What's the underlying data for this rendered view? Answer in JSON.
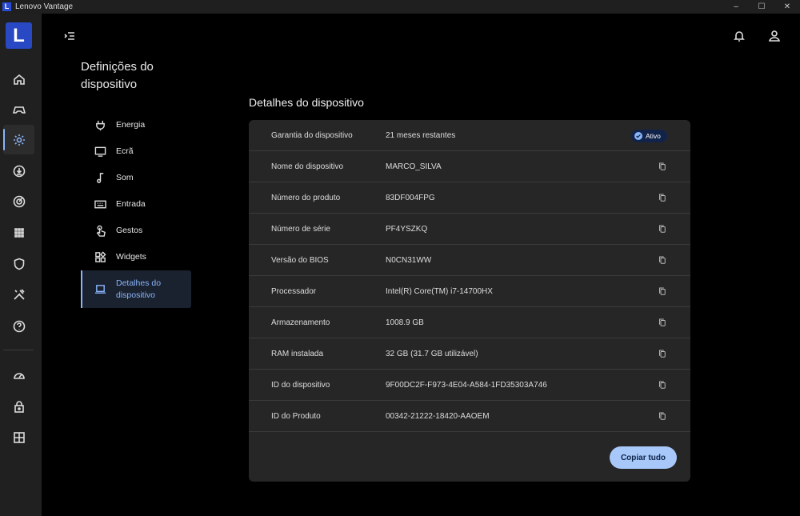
{
  "window": {
    "title": "Lenovo Vantage",
    "logo": "L",
    "minimize": "–",
    "maximize": "☐",
    "close": "✕"
  },
  "rail": {
    "brand": "L",
    "items": [
      "home-icon",
      "gamepad-icon",
      "gear-icon",
      "download-icon",
      "radar-icon",
      "apps-grid-icon",
      "shield-icon",
      "tools-icon",
      "help-icon",
      "speedometer-icon",
      "lock-icon",
      "dashboard-icon"
    ],
    "active": "gear-icon"
  },
  "section": {
    "title": "Definições do dispositivo"
  },
  "menu": [
    {
      "label": "Energia",
      "icon": "plug-icon"
    },
    {
      "label": "Ecrã",
      "icon": "monitor-icon"
    },
    {
      "label": "Som",
      "icon": "music-note-icon"
    },
    {
      "label": "Entrada",
      "icon": "keyboard-icon"
    },
    {
      "label": "Gestos",
      "icon": "touch-hand-icon"
    },
    {
      "label": "Widgets",
      "icon": "widgets-icon"
    },
    {
      "label": "Detalhes do dispositivo",
      "icon": "laptop-icon",
      "active": true
    }
  ],
  "main": {
    "heading": "Detalhes do dispositivo",
    "rows": [
      {
        "label": "Garantia do dispositivo",
        "value": "21 meses restantes",
        "badge": "Ativo"
      },
      {
        "label": "Nome do dispositivo",
        "value": "MARCO_SILVA"
      },
      {
        "label": "Número do produto",
        "value": "83DF004FPG"
      },
      {
        "label": "Número de série",
        "value": "PF4YSZKQ"
      },
      {
        "label": "Versão do BIOS",
        "value": "N0CN31WW"
      },
      {
        "label": "Processador",
        "value": "Intel(R) Core(TM) i7-14700HX"
      },
      {
        "label": "Armazenamento",
        "value": "1008.9 GB"
      },
      {
        "label": "RAM instalada",
        "value": "32 GB (31.7 GB utilizável)"
      },
      {
        "label": "ID do dispositivo",
        "value": "9F00DC2F-F973-4E04-A584-1FD35303A746"
      },
      {
        "label": "ID do Produto",
        "value": "00342-21222-18420-AAOEM"
      }
    ],
    "copy_all": "Copiar tudo"
  },
  "colors": {
    "accent": "#8ab4f8",
    "button": "#a8c8fa",
    "brand": "#2848c4",
    "card": "#262626"
  }
}
